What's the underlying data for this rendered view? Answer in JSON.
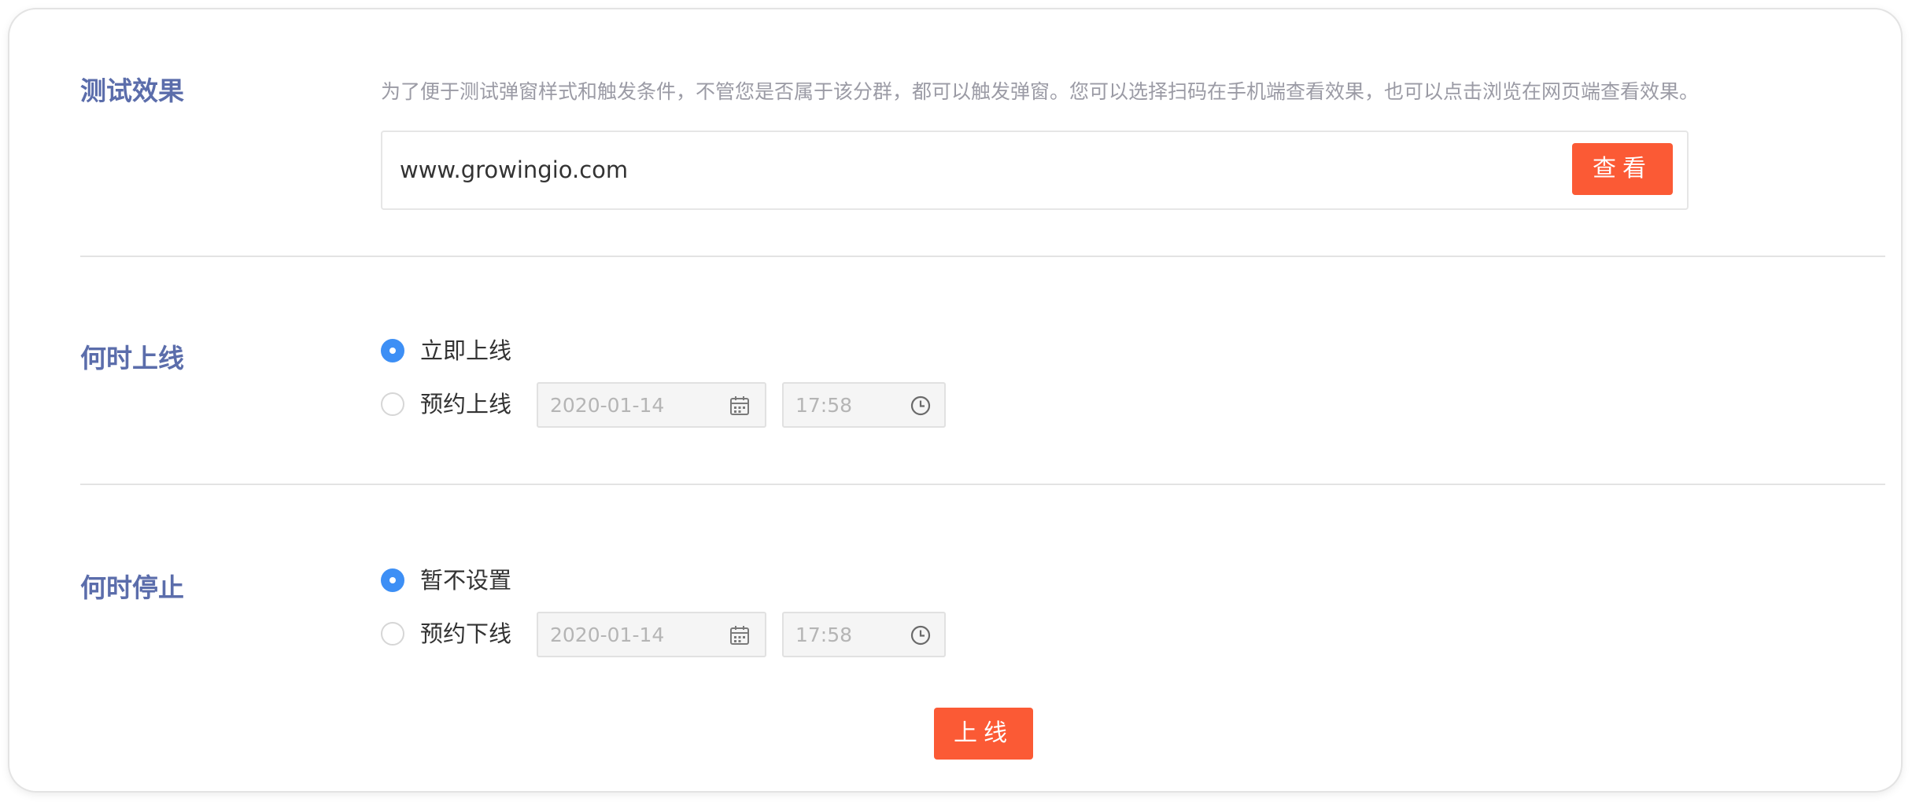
{
  "test_effect": {
    "title": "测试效果",
    "description": "为了便于测试弹窗样式和触发条件，不管您是否属于该分群，都可以触发弹窗。您可以选择扫码在手机端查看效果，也可以点击浏览在网页端查看效果。",
    "url_value": "www.growingio.com",
    "view_button": "查看"
  },
  "go_online": {
    "title": "何时上线",
    "options": [
      {
        "label": "立即上线",
        "checked": true
      },
      {
        "label": "预约上线",
        "checked": false
      }
    ],
    "date_placeholder": "2020-01-14",
    "time_placeholder": "17:58"
  },
  "stop": {
    "title": "何时停止",
    "options": [
      {
        "label": "暂不设置",
        "checked": true
      },
      {
        "label": "预约下线",
        "checked": false
      }
    ],
    "date_placeholder": "2020-01-14",
    "time_placeholder": "17:58"
  },
  "online_button": "上线",
  "colors": {
    "accent_orange": "#fb5a35",
    "radio_blue": "#3d8ff5",
    "title_blue": "#5b6dab"
  },
  "icons": {
    "date": "calendar-icon",
    "time": "clock-icon"
  }
}
